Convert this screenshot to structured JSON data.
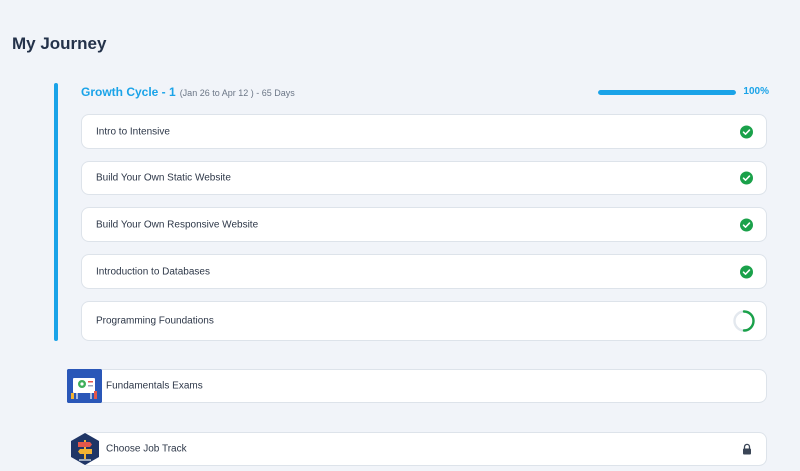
{
  "page": {
    "title": "My Journey"
  },
  "cycle": {
    "title": "Growth Cycle - 1",
    "dates": "(Jan 26 to Apr 12 ) - 65 Days",
    "progress_percent": 100,
    "progress_label": "100%",
    "accent_color": "#1aa3e8"
  },
  "modules": [
    {
      "label": "Intro to Intensive",
      "status": "completed",
      "icon": "check-circle-icon"
    },
    {
      "label": "Build Your Own Static Website",
      "status": "completed",
      "icon": "check-circle-icon"
    },
    {
      "label": "Build Your Own Responsive Website",
      "status": "completed",
      "icon": "check-circle-icon"
    },
    {
      "label": "Introduction to Databases",
      "status": "completed",
      "icon": "check-circle-icon"
    },
    {
      "label": "Programming Foundations",
      "status": "in-progress",
      "icon": "progress-ring-icon"
    }
  ],
  "exams": {
    "label": "Fundamentals Exams",
    "icon": "exam-badge-icon"
  },
  "job_track": {
    "label": "Choose Job Track",
    "icon": "signpost-badge-icon",
    "status_icon": "lock-icon"
  },
  "colors": {
    "completed": "#1aa14a",
    "background": "#f1f4f9"
  }
}
